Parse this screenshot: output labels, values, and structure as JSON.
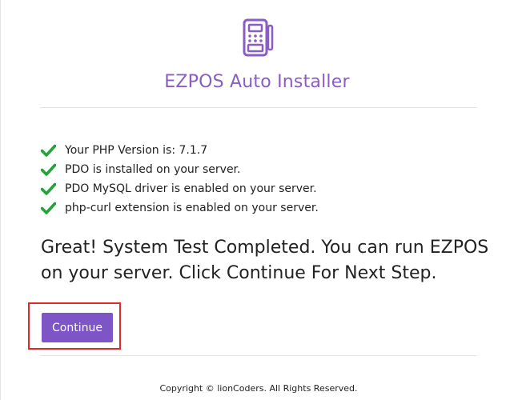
{
  "header": {
    "logo_icon": "pos-terminal-icon",
    "title": "EZPOS Auto Installer"
  },
  "checks": [
    {
      "icon": "check-icon",
      "text": "Your PHP Version is: 7.1.7"
    },
    {
      "icon": "check-icon",
      "text": "PDO is installed on your server."
    },
    {
      "icon": "check-icon",
      "text": "PDO MySQL driver is enabled on your server."
    },
    {
      "icon": "check-icon",
      "text": "php-curl extension is enabled on your server."
    }
  ],
  "result_message": "Great! System Test Completed. You can run EZPOS on your server. Click Continue For Next Step.",
  "actions": {
    "continue_label": "Continue"
  },
  "footer": {
    "copyright": "Copyright © lionCoders. All Rights Reserved."
  },
  "colors": {
    "accent": "#7d55c7",
    "title": "#8a5cc6",
    "success": "#22a43a",
    "highlight": "#e0282e"
  }
}
